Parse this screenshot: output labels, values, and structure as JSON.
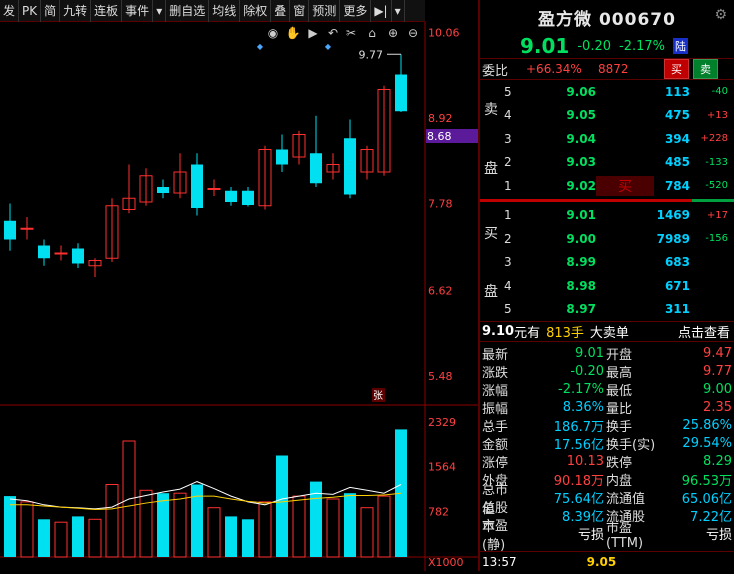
{
  "toolbar": {
    "buttons": [
      "发",
      "PK",
      "简",
      "九转",
      "连板",
      "事件",
      "▾",
      "删自选",
      "均线",
      "除权",
      "叠",
      "窗",
      "预测",
      "更多",
      "▶|",
      "▾"
    ]
  },
  "chart": {
    "price_axis": [
      "10.06",
      "8.92",
      "8.68",
      "7.78",
      "6.62",
      "5.48"
    ],
    "current_price_tag": "8.68",
    "high_label": "9.77",
    "vol_axis": [
      "2329",
      "1564",
      "782",
      "X1000"
    ],
    "zhang_marker": "张"
  },
  "chart_data": {
    "type": "candlestick",
    "candles": [
      {
        "o": 7.55,
        "c": 7.3,
        "h": 7.78,
        "l": 7.15
      },
      {
        "o": 7.45,
        "c": 7.45,
        "h": 7.6,
        "l": 7.3
      },
      {
        "o": 7.22,
        "c": 7.05,
        "h": 7.3,
        "l": 6.95
      },
      {
        "o": 7.12,
        "c": 7.12,
        "h": 7.22,
        "l": 7.02
      },
      {
        "o": 7.18,
        "c": 6.98,
        "h": 7.25,
        "l": 6.92
      },
      {
        "o": 6.95,
        "c": 7.02,
        "h": 7.05,
        "l": 6.8
      },
      {
        "o": 7.05,
        "c": 7.75,
        "h": 7.85,
        "l": 7.0
      },
      {
        "o": 7.7,
        "c": 7.85,
        "h": 8.3,
        "l": 7.65
      },
      {
        "o": 7.8,
        "c": 8.15,
        "h": 8.25,
        "l": 7.75
      },
      {
        "o": 8.0,
        "c": 7.92,
        "h": 8.1,
        "l": 7.85
      },
      {
        "o": 7.92,
        "c": 8.2,
        "h": 8.45,
        "l": 7.85
      },
      {
        "o": 8.3,
        "c": 7.72,
        "h": 8.45,
        "l": 7.62
      },
      {
        "o": 7.98,
        "c": 7.98,
        "h": 8.1,
        "l": 7.88
      },
      {
        "o": 7.95,
        "c": 7.8,
        "h": 8.0,
        "l": 7.75
      },
      {
        "o": 7.95,
        "c": 7.76,
        "h": 8.0,
        "l": 7.74
      },
      {
        "o": 7.75,
        "c": 8.5,
        "h": 8.55,
        "l": 7.7
      },
      {
        "o": 8.5,
        "c": 8.3,
        "h": 8.7,
        "l": 8.2
      },
      {
        "o": 8.4,
        "c": 8.7,
        "h": 8.75,
        "l": 8.3
      },
      {
        "o": 8.45,
        "c": 8.05,
        "h": 8.95,
        "l": 8.0
      },
      {
        "o": 8.2,
        "c": 8.3,
        "h": 8.45,
        "l": 8.1
      },
      {
        "o": 8.65,
        "c": 7.9,
        "h": 8.9,
        "l": 7.85
      },
      {
        "o": 8.2,
        "c": 8.5,
        "h": 8.55,
        "l": 8.1
      },
      {
        "o": 8.2,
        "c": 9.3,
        "h": 9.35,
        "l": 8.15
      },
      {
        "o": 9.5,
        "c": 9.01,
        "h": 9.77,
        "l": 9.0
      }
    ],
    "volume": [
      1050,
      950,
      650,
      600,
      700,
      650,
      1250,
      2000,
      1150,
      1100,
      1100,
      1250,
      850,
      700,
      650,
      950,
      1750,
      1050,
      1300,
      1000,
      1100,
      850,
      1050,
      2200
    ],
    "ma_a": [
      1000,
      970,
      900,
      860,
      850,
      830,
      860,
      1000,
      1060,
      1120,
      1170,
      1300,
      1180,
      1050,
      950,
      900,
      1000,
      1050,
      1100,
      1080,
      1200,
      1150,
      1100,
      1250
    ],
    "ma_b": [
      900,
      900,
      880,
      860,
      840,
      820,
      830,
      880,
      930,
      970,
      1000,
      1050,
      1050,
      1000,
      960,
      930,
      950,
      980,
      1010,
      1030,
      1060,
      1060,
      1070,
      1100
    ],
    "ylim": [
      5.2,
      10.2
    ],
    "vol_max": 2500
  },
  "quote": {
    "name_code": "盈方微 000670",
    "price": "9.01",
    "change": "-0.20",
    "change_pct": "-2.17%",
    "board_tag": "陆",
    "wb_label": "委比",
    "wb_value": "+66.34%",
    "wc_value": "8872",
    "buy_btn": "买",
    "sell_btn": "卖"
  },
  "orderbook": {
    "sell_side_label": [
      "卖",
      "盘"
    ],
    "buy_side_label": [
      "买",
      "盘"
    ],
    "asks": [
      {
        "lv": "5",
        "price": "9.06",
        "vol": "113",
        "delta": "-40",
        "dir": "dn"
      },
      {
        "lv": "4",
        "price": "9.05",
        "vol": "475",
        "delta": "+13",
        "dir": "up"
      },
      {
        "lv": "3",
        "price": "9.04",
        "vol": "394",
        "delta": "+228",
        "dir": "up"
      },
      {
        "lv": "2",
        "price": "9.03",
        "vol": "485",
        "delta": "-133",
        "dir": "dn"
      },
      {
        "lv": "1",
        "price": "9.02",
        "vol": "784",
        "delta": "-520",
        "dir": "dn",
        "hl": "买"
      }
    ],
    "bids": [
      {
        "lv": "1",
        "price": "9.01",
        "vol": "1469",
        "delta": "+17",
        "dir": "up"
      },
      {
        "lv": "2",
        "price": "9.00",
        "vol": "7989",
        "delta": "-156",
        "dir": "dn"
      },
      {
        "lv": "3",
        "price": "8.99",
        "vol": "683",
        "delta": "",
        "dir": ""
      },
      {
        "lv": "4",
        "price": "8.98",
        "vol": "671",
        "delta": "",
        "dir": ""
      },
      {
        "lv": "5",
        "price": "8.97",
        "vol": "311",
        "delta": "",
        "dir": ""
      }
    ]
  },
  "bigorder": {
    "price": "9.10",
    "yuan_you": "元有",
    "qty": "813手",
    "label": "大卖单",
    "link": "点击查看"
  },
  "stats": [
    {
      "k1": "最新",
      "v1": "9.01",
      "c1": "green",
      "k2": "开盘",
      "v2": "9.47",
      "c2": "red"
    },
    {
      "k1": "涨跌",
      "v1": "-0.20",
      "c1": "green",
      "k2": "最高",
      "v2": "9.77",
      "c2": "red"
    },
    {
      "k1": "涨幅",
      "v1": "-2.17%",
      "c1": "green",
      "k2": "最低",
      "v2": "9.00",
      "c2": "green"
    },
    {
      "k1": "振幅",
      "v1": "8.36%",
      "c1": "cyan",
      "k2": "量比",
      "v2": "2.35",
      "c2": "red"
    },
    {
      "k1": "总手",
      "v1": "186.7万",
      "c1": "cyan",
      "k2": "换手",
      "v2": "25.86%",
      "c2": "cyan"
    },
    {
      "k1": "金额",
      "v1": "17.56亿",
      "c1": "cyan",
      "k2": "换手(实)",
      "v2": "29.54%",
      "c2": "cyan"
    },
    {
      "k1": "涨停",
      "v1": "10.13",
      "c1": "red",
      "k2": "跌停",
      "v2": "8.29",
      "c2": "green"
    },
    {
      "k1": "外盘",
      "v1": "90.18万",
      "c1": "red",
      "k2": "内盘",
      "v2": "96.53万",
      "c2": "green"
    },
    {
      "k1": "总市值",
      "v1": "75.64亿",
      "c1": "cyan",
      "k2": "流通值",
      "v2": "65.06亿",
      "c2": "cyan"
    },
    {
      "k1": "总股本",
      "v1": "8.39亿",
      "c1": "cyan",
      "k2": "流通股",
      "v2": "7.22亿",
      "c2": "cyan"
    },
    {
      "k1": "市盈(静)",
      "v1": "亏损",
      "c1": "white",
      "k2": "市盈(TTM)",
      "v2": "亏损",
      "c2": "white"
    }
  ],
  "bottom": {
    "time": "13:57",
    "price": "9.05"
  }
}
